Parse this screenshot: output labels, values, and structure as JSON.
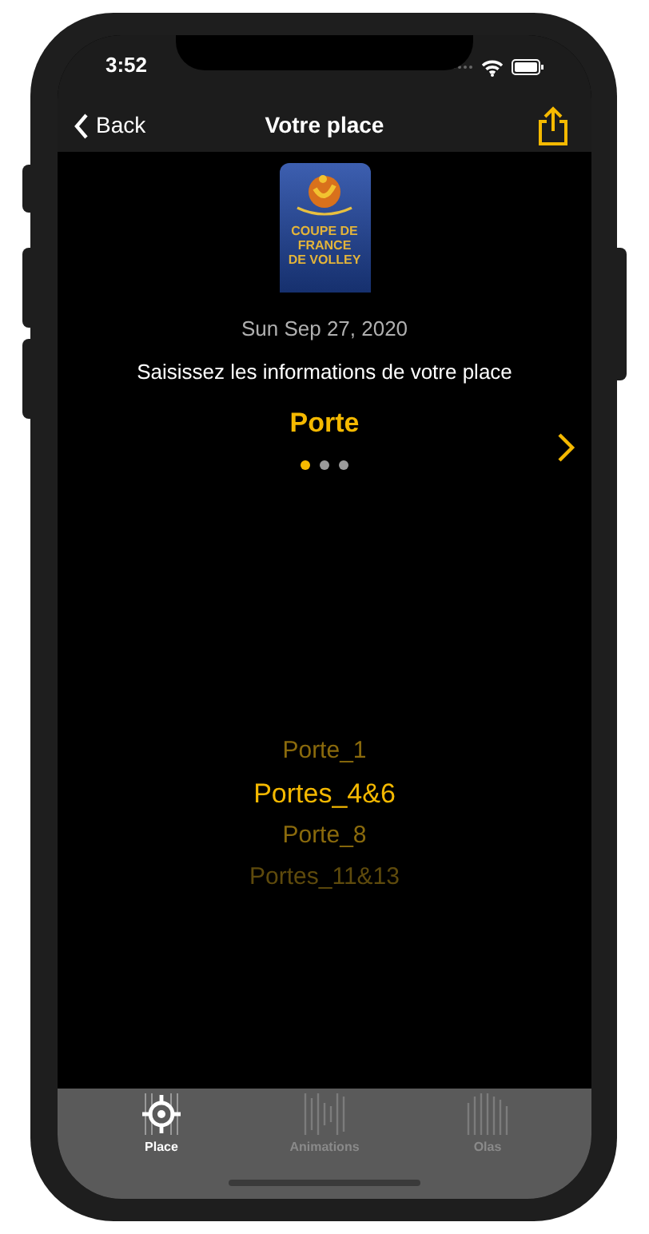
{
  "status_bar": {
    "time": "3:52"
  },
  "nav": {
    "back": "Back",
    "title": "Votre place"
  },
  "logo": {
    "lines": [
      "COUPE DE",
      "FRANCE",
      "DE VOLLEY"
    ]
  },
  "date": "Sun Sep 27, 2020",
  "instruction": "Saisissez les informations de votre place",
  "step_title": "Porte",
  "pages": [
    {
      "selected": true
    },
    {
      "selected": false
    },
    {
      "selected": false
    }
  ],
  "picker": [
    {
      "label": "Porte_1",
      "selected": false
    },
    {
      "label": "Portes_4&6",
      "selected": true
    },
    {
      "label": "Porte_8",
      "selected": false
    },
    {
      "label": "Portes_11&13",
      "selected": false
    }
  ],
  "tabs": [
    {
      "label": "Place",
      "selected": true
    },
    {
      "label": "Animations",
      "selected": false
    },
    {
      "label": "Olas",
      "selected": false
    }
  ]
}
